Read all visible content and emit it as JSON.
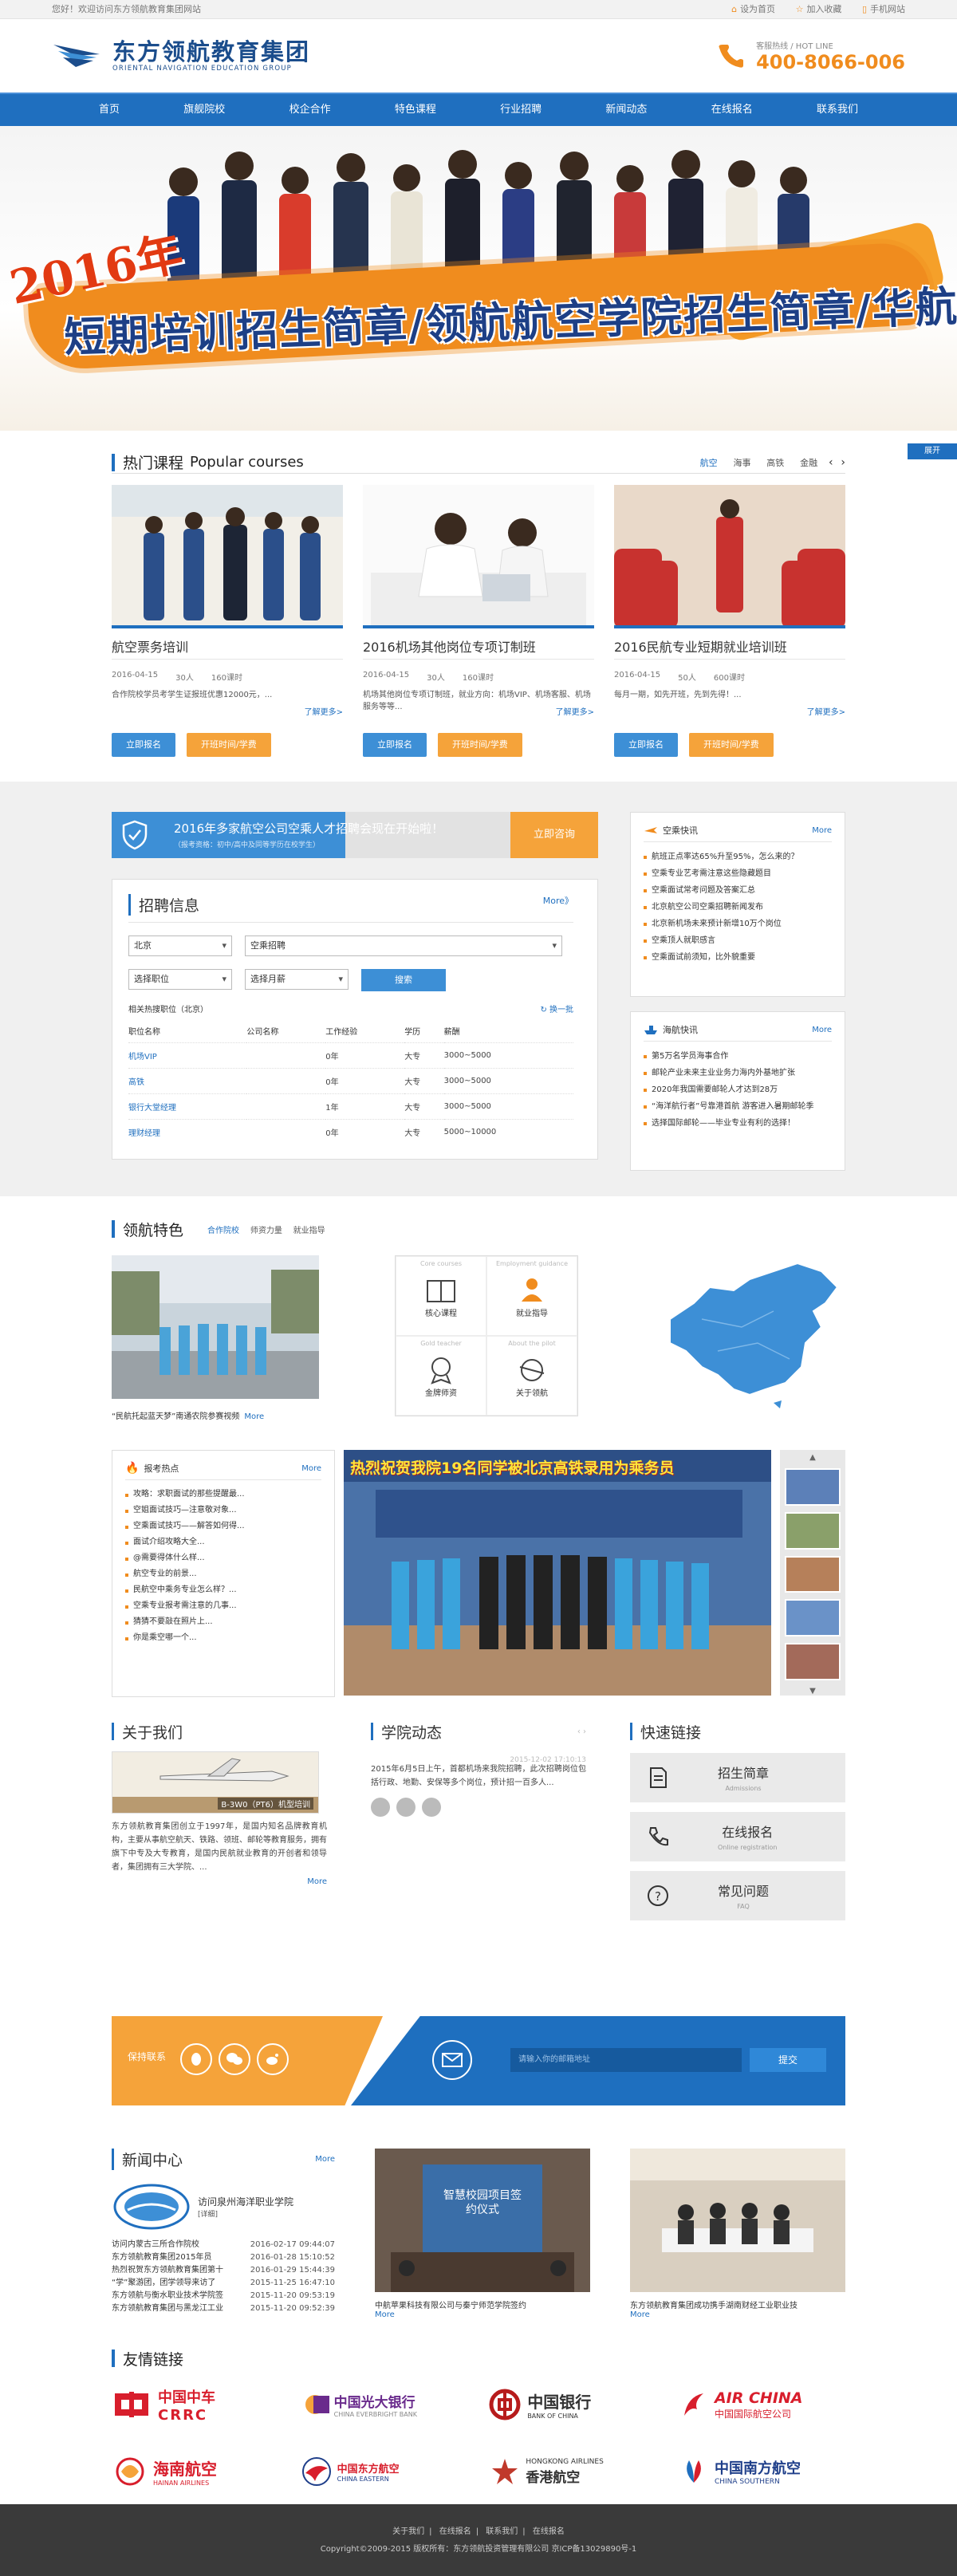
{
  "topbar": {
    "welcome": "您好！欢迎访问东方领航教育集团网站",
    "links": [
      "设为首页",
      "加入收藏",
      "手机网站"
    ]
  },
  "header": {
    "logo_cn": "东方领航教育集团",
    "logo_en": "ORIENTAL NAVIGATION EDUCATION GROUP",
    "hotline_label": "客服热线 / HOT LINE",
    "hotline": "400-8066-006"
  },
  "nav": [
    "首页",
    "旗舰院校",
    "校企合作",
    "特色课程",
    "行业招聘",
    "新闻动态",
    "在线报名",
    "联系我们"
  ],
  "banner": {
    "year": "2016年",
    "headline": "短期培训招生简章/领航航空学院招生简章/华航招生简章"
  },
  "side_tab": "展开",
  "courses": {
    "title": "热门课程",
    "title_en": "Popular courses",
    "tabs": [
      "航空",
      "海事",
      "高铁",
      "金融"
    ],
    "items": [
      {
        "title": "航空票务培训",
        "date": "2016-04-15",
        "people": "30人",
        "hours": "160课时",
        "desc": "合作院校学员考学生证报班优惠12000元，...",
        "more": "了解更多>",
        "btn1": "立即报名",
        "btn2": "开班时间/学费"
      },
      {
        "title": "2016机场其他岗位专项订制班",
        "date": "2016-04-15",
        "people": "30人",
        "hours": "160课时",
        "desc": "机场其他岗位专项订制班，就业方向：机场VIP、机场客服、机场服务等等...",
        "more": "了解更多>",
        "btn1": "立即报名",
        "btn2": "开班时间/学费"
      },
      {
        "title": "2016民航专业短期就业培训班",
        "date": "2016-04-15",
        "people": "50人",
        "hours": "600课时",
        "desc": "每月一期，如先开班，先到先得！...",
        "more": "了解更多>",
        "btn1": "立即报名",
        "btn2": "开班时间/学费"
      }
    ]
  },
  "recruit": {
    "notice": "2016年多家航空公司空乘人才招聘会现在开始啦！",
    "notice_sub": "（报考资格：初中/高中及同等学历在校学生）",
    "apply": "立即咨询",
    "box_title": "招聘信息",
    "more": "More》",
    "city": "北京",
    "type": "空乘招聘",
    "position": "选择职位",
    "month": "选择月薪",
    "search": "搜索",
    "jobs_label": "相关热搜职位（北京）",
    "change": "换一批",
    "headers": [
      "职位名称",
      "公司名称",
      "工作经验",
      "学历",
      "薪酬"
    ],
    "rows": [
      [
        "机场VIP",
        "",
        "0年",
        "大专",
        "3000~5000"
      ],
      [
        "高铁",
        "",
        "0年",
        "大专",
        "3000~5000"
      ],
      [
        "银行大堂经理",
        "",
        "1年",
        "大专",
        "3000~5000"
      ],
      [
        "理财经理",
        "",
        "0年",
        "大专",
        "5000~10000"
      ]
    ]
  },
  "airnews": {
    "title": "空乘快讯",
    "more": "More",
    "items": [
      "航班正点率达65%升至95%，怎么来的？",
      "空乘专业艺考需注意这些隐藏题目",
      "空乘面试常考问题及答案汇总",
      "北京航空公司空乘招聘新闻发布",
      "北京新机场未来预计新增10万个岗位",
      "空乘顶人就职感言",
      "空乘面试前须知，比外貌重要"
    ]
  },
  "seanews": {
    "title": "海航快讯",
    "more": "More",
    "items": [
      "第5万名学员海事合作",
      "邮轮产业未来主业业务力海内外基地扩张",
      "2020年我国需要邮轮人才达到28万",
      "“海洋航行者”号靠港首航 游客进入暑期邮轮季",
      "选择国际邮轮——毕业专业有利的选择！"
    ]
  },
  "feature": {
    "title": "领航特色",
    "tabs": [
      "合作院校",
      "师资力量",
      "就业指导"
    ],
    "photo_cap": "“民航托起蓝天梦”南通农院参赛视频",
    "photo_more": "More",
    "grid": [
      {
        "en": "Core courses",
        "cn": "核心课程"
      },
      {
        "en": "Employment guidance",
        "cn": "就业指导"
      },
      {
        "en": "Gold teacher",
        "cn": "金牌师资"
      },
      {
        "en": "About the pilot",
        "cn": "关于领航"
      }
    ]
  },
  "hot": {
    "title": "报考热点",
    "more": "More",
    "items": [
      "攻略：求职面试的那些提醒最...",
      "空姐面试技巧—注意敬对象...",
      "空乘面试技巧——解答如何得...",
      "面试介绍攻略大全...",
      "@需要得体什么样...",
      "航空专业的前景...",
      "民航空中乘务专业怎么样？...",
      "空乘专业报考需注意的几事...",
      "猜猜不要敲在照片上...",
      "你是乘空哪一个..."
    ]
  },
  "slide_caption": "热烈祝贺我院19名同学被北京高铁录用为乘务员",
  "about": {
    "title": "关于我们",
    "img_caption": "B-3W0（PT6）机型培训",
    "text": "东方领航教育集团创立于1997年，是国内知名品牌教育机构，主要从事航空航天、铁路、领班、邮轮等教育服务，拥有旗下中专及大专教育，是国内民航就业教育的开创者和领导者，集团拥有三大学院、...",
    "more": "More"
  },
  "dynamic": {
    "title": "学院动态",
    "date": "2015-12-02 17:10:13",
    "text": "2015年6月5日上午，首都机场来我院招聘，此次招聘岗位包括行政、地勤、安保等多个岗位，预计招一百多人..."
  },
  "quick": {
    "title": "快速链接",
    "items": [
      {
        "cn": "招生简章",
        "en": "Admissions"
      },
      {
        "cn": "在线报名",
        "en": "Online registration"
      },
      {
        "cn": "常见问题",
        "en": "FAQ"
      }
    ]
  },
  "subscribe": {
    "label": "保持联系",
    "placeholder": "请输入你的邮箱地址",
    "btn": "提交"
  },
  "news": {
    "title": "新闻中心",
    "more": "More",
    "featured": "访问泉州海洋职业学院",
    "detail": "[详细]",
    "items": [
      [
        "访问内蒙古三所合作院校",
        "2016-02-17 09:44:07"
      ],
      [
        "东方领航教育集团2015年员",
        "2016-01-28 15:10:52"
      ],
      [
        "热烈祝贺东方领航教育集团第十",
        "2016-01-29 15:44:39"
      ],
      [
        "“学”聚游团，团学领导来访了",
        "2015-11-25 16:47:10"
      ],
      [
        "东方领航与衡水职业技术学院签",
        "2015-11-20 09:53:19"
      ],
      [
        "东方领航教育集团与黑龙江工业",
        "2015-11-20 09:52:39"
      ]
    ],
    "img1_cap": "中航苹果科技有限公司与秦宁师范学院签约",
    "img2_cap": "东方领航教育集团成功携手湖南财经工业职业技",
    "img_more": "More",
    "sign_text": "智慧校园项目签约仪式"
  },
  "friends": {
    "title": "友情链接",
    "logos": [
      {
        "cn": "中国中车",
        "en": "CRRC"
      },
      {
        "cn": "中国光大银行",
        "en": "CHINA EVERBRIGHT BANK"
      },
      {
        "cn": "中国银行",
        "en": "BANK OF CHINA"
      },
      {
        "cn": "中国国际航空公司",
        "en": "AIR CHINA"
      },
      {
        "cn": "海南航空",
        "en": "HAINAN AIRLINES"
      },
      {
        "cn": "中国东方航空",
        "en": "CHINA EASTERN"
      },
      {
        "cn": "香港航空",
        "en": "HONGKONG AIRLINES"
      },
      {
        "cn": "中国南方航空",
        "en": "CHINA SOUTHERN"
      }
    ]
  },
  "footer": {
    "links": [
      "关于我们",
      "在线报名",
      "联系我们",
      "在线报名"
    ],
    "copyright": "Copyright©2009-2015 版权所有：东方领航投资管理有限公司 京ICP备13029890号-1"
  },
  "colors": {
    "primary": "#1f6fbf",
    "accent": "#f5a33a",
    "banner_red": "#e23a12"
  }
}
